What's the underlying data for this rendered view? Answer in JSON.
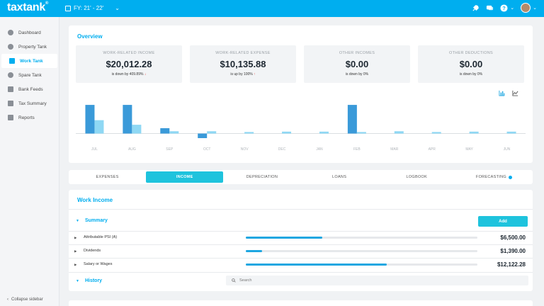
{
  "app": {
    "logo": "taxtank",
    "logo_mark": "®",
    "financial_year": "FY: 21' - 22'"
  },
  "topbar_icons": [
    "rocket-icon",
    "chat-icon",
    "help-icon",
    "avatar"
  ],
  "sidebar": {
    "items": [
      {
        "label": "Dashboard",
        "icon": "dashboard-icon",
        "active": false
      },
      {
        "label": "Property Tank",
        "icon": "property-icon",
        "active": false
      },
      {
        "label": "Work Tank",
        "icon": "work-icon",
        "active": true
      },
      {
        "label": "Spare Tank",
        "icon": "spare-icon",
        "active": false
      },
      {
        "label": "Bank Feeds",
        "icon": "bank-icon",
        "active": false
      },
      {
        "label": "Tax Summary",
        "icon": "tax-summary-icon",
        "active": false
      },
      {
        "label": "Reports",
        "icon": "reports-icon",
        "active": false
      }
    ],
    "collapse_label": "Collapse sidebar"
  },
  "overview": {
    "title": "Overview",
    "cards": [
      {
        "label": "WORK-RELATED INCOME",
        "value": "$20,012.28",
        "change_text": "is down by 409.89%",
        "direction": "down"
      },
      {
        "label": "WORK-RELATED EXPENSE",
        "value": "$10,135.88",
        "change_text": "is up by 100%",
        "direction": "up"
      },
      {
        "label": "OTHER INCOMES",
        "value": "$0.00",
        "change_text": "is down by 0%",
        "direction": "none"
      },
      {
        "label": "OTHER DEDUCTIONS",
        "value": "$0.00",
        "change_text": "is down by 0%",
        "direction": "none"
      }
    ],
    "chart_toggle_icons": [
      "bar-chart-icon",
      "line-chart-icon"
    ]
  },
  "chart_data": {
    "type": "bar",
    "categories": [
      "JUL",
      "AUG",
      "SEP",
      "OCT",
      "NOV",
      "DEC",
      "JAN",
      "FEB",
      "MAR",
      "APR",
      "MAY",
      "JUN"
    ],
    "series": [
      {
        "values": [
          7500,
          7500,
          1400,
          -1200,
          0,
          0,
          0,
          7500,
          0,
          0,
          0,
          0
        ],
        "color": "#3a9ad9"
      },
      {
        "values": [
          3500,
          2300,
          600,
          600,
          400,
          500,
          500,
          400,
          600,
          400,
          500,
          500
        ],
        "color": "#8fd8f4"
      }
    ],
    "ylim": [
      -2500,
      9000
    ],
    "grid": false,
    "legend": "none"
  },
  "tabs": [
    {
      "label": "EXPENSES",
      "active": false
    },
    {
      "label": "INCOME",
      "active": true
    },
    {
      "label": "DEPRECIATION",
      "active": false
    },
    {
      "label": "LOANS",
      "active": false
    },
    {
      "label": "LOGBOOK",
      "active": false
    },
    {
      "label": "FORECASTING",
      "active": false,
      "info": true
    }
  ],
  "work_income": {
    "title": "Work Income",
    "summary_label": "Summary",
    "add_label": "Add",
    "rows": [
      {
        "label": "Attributable PSI (A)",
        "amount": "$6,500.00",
        "progress": 0.33
      },
      {
        "label": "Dividends",
        "amount": "$1,390.00",
        "progress": 0.07
      },
      {
        "label": "Salary or Wages",
        "amount": "$12,122.28",
        "progress": 0.61
      }
    ],
    "history_label": "History",
    "search_placeholder": "Search"
  }
}
